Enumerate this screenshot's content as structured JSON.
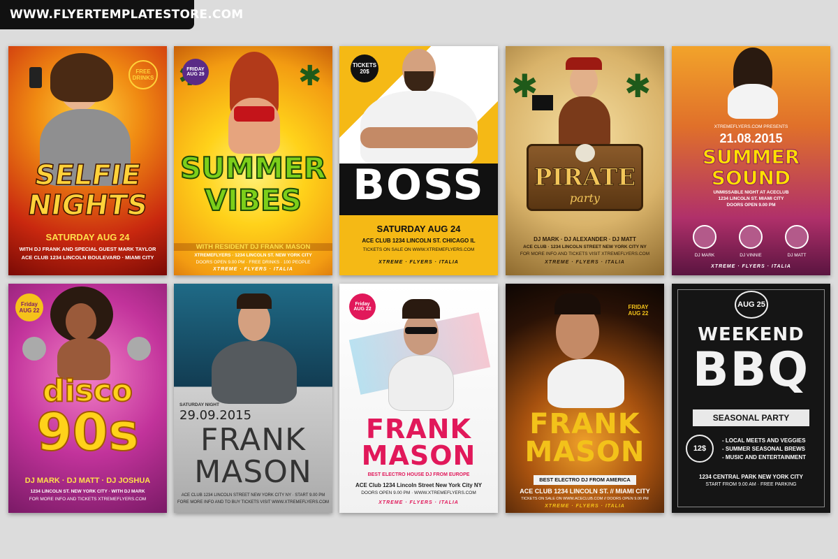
{
  "banner": "WWW.FLYERTEMPLATESTORE.COM",
  "brands": "XTREME · FLYERS · ITALIA",
  "flyers": [
    {
      "title1": "SELFIE",
      "title2": "NIGHTS",
      "badge": "FREE DRINKS",
      "date": "SATURDAY AUG 24",
      "line1": "WITH DJ FRANK AND SPECIAL GUEST MARK TAYLOR",
      "line2": "ACE CLUB 1234 LINCOLN BOULEVARD · MIAMI CITY"
    },
    {
      "date_badge": "FRIDAY AUG 29",
      "title1": "SUMMER",
      "title2": "VIBES",
      "line1": "WITH RESIDENT DJ FRANK MASON",
      "line2": "XTREMEFLYERS · 1234 LINCOLN ST. NEW YORK CITY",
      "line3": "DOORS OPEN 9.00 PM · FREE DRINKS · 100 PEOPLE"
    },
    {
      "ticket": "TICKETS 20$",
      "title": "BOSS",
      "date": "SATURDAY AUG 24",
      "line1": "ACE CLUB 1234 LINCOLN ST. CHICAGO IL",
      "line2": "TICKETS ON SALE ON WWW.XTREMEFLYERS.COM"
    },
    {
      "title": "PIRATE",
      "subtitle": "party",
      "line1": "DJ MARK · DJ ALEXANDER · DJ MATT",
      "line2": "ACE CLUB · 1234 LINCOLN STREET NEW YORK CITY NY",
      "line3": "FOR MORE INFO AND TICKETS VISIT XTREMEFLYERS.COM"
    },
    {
      "presents": "XTREMEFLYERS.COM PRESENTS",
      "date": "21.08.2015",
      "title1": "SUMMER",
      "title2": "SOUND",
      "line1": "UNMISSABLE NIGHT AT ACECLUB",
      "line2": "1234 LINCOLN ST. MIAMI CITY",
      "line3": "DOORS OPEN 9.00 PM",
      "djs": [
        "DJ MARK",
        "DJ VINNIE",
        "DJ MATT"
      ]
    },
    {
      "date_badge": "Friday AUG 22",
      "title1": "disco",
      "title2": "90s",
      "line1": "DJ MARK · DJ MATT · DJ JOSHUA",
      "line2": "1234 LINCOLN ST. NEW YORK CITY · WITH DJ MARK",
      "line3": "FOR MORE INFO AND TICKETS XTREMEFLYERS.COM"
    },
    {
      "pre": "SATURDAY NIGHT",
      "date": "29.09.2015",
      "title1": "FRANK",
      "title2": "MASON",
      "line1": "ACE CLUB 1234 LINCOLN STREET NEW YORK CITY NY · START 9.00 PM",
      "line2": "FORE MORE INFO AND TO BUY TICKETS VISIT WWW.XTREMEFLYERS.COM"
    },
    {
      "date_badge": "Friday AUG 22",
      "title1": "FRANK",
      "title2": "MASON",
      "sub": "BEST ELECTRO HOUSE DJ FROM EUROPE",
      "line1": "ACE Club 1234 Lincoln Street New York City NY",
      "line2": "DOORS OPEN 9.00 PM · WWW.XTREMEFLYERS.COM"
    },
    {
      "date_badge": "FRIDAY AUG 22",
      "title1": "FRANK",
      "title2": "MASON",
      "sub": "BEST ELECTRO DJ FROM AMERICA",
      "line1": "ACE CLUB 1234 LINCOLN ST. // MIAMI CITY",
      "line2": "TICKETS ON SALE ON WWW.ACECLUB.COM // DOORS OPEN 9.00 PM"
    },
    {
      "date": "AUG 25",
      "title1": "WEEKEND",
      "title2": "BBQ",
      "sub": "SEASONAL PARTY",
      "price": "12$",
      "items": [
        "- LOCAL MEETS AND VEGGIES",
        "- SUMMER SEASONAL BREWS",
        "- MUSIC AND ENTERTAINMENT"
      ],
      "line1": "1234 CENTRAL PARK NEW YORK CITY",
      "line2": "START FROM 9.00 AM · FREE PARKING"
    }
  ]
}
